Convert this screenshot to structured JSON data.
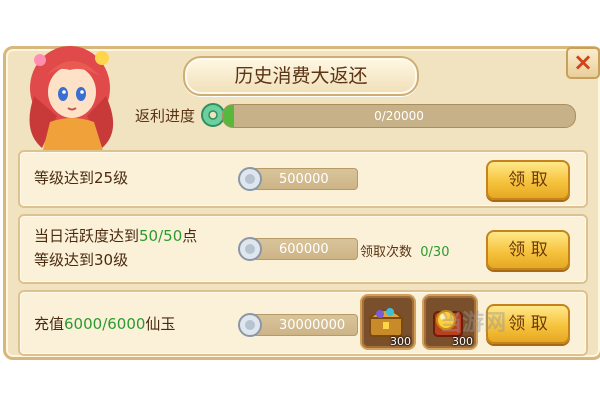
{
  "dialog": {
    "title": "历史消费大返还",
    "close_symbol": "×"
  },
  "progress": {
    "label": "返利进度",
    "current": 0,
    "max": 20000,
    "text": "0/20000",
    "fill_fraction": 0.03
  },
  "rows": [
    {
      "prefix": "等级达到25级",
      "amount": "500000",
      "claim_label": "领 取"
    },
    {
      "line1_prefix": "当日活跃度达到",
      "line1_hl": "50/50",
      "line1_suffix": "点",
      "line2": "等级达到30级",
      "amount": "600000",
      "claim_count_label": "领取次数",
      "claim_count_value": "0/30",
      "claim_label": "领 取"
    },
    {
      "prefix": "充值",
      "hl": "6000/6000",
      "suffix": "仙玉",
      "amount": "30000000",
      "rewards": [
        {
          "icon": "treasure-chest-icon",
          "qty": "300"
        },
        {
          "icon": "gold-orb-bag-icon",
          "qty": "300"
        }
      ],
      "claim_label": "领 取"
    }
  ],
  "watermark": "当游网",
  "colors": {
    "panel_bg": "#f2e3c0",
    "row_bg": "#fbf1d9",
    "highlight_green": "#2c9a2e",
    "button_gold": "#f6c33d",
    "close_red": "#d2421b"
  }
}
